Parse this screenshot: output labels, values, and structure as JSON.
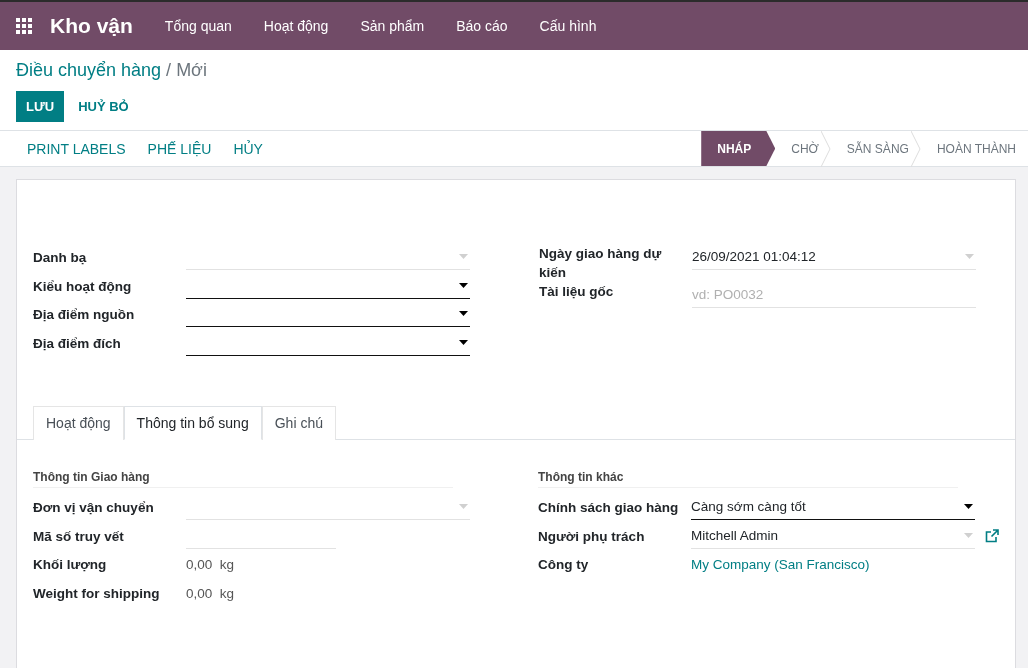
{
  "navbar": {
    "app_name": "Kho vận",
    "menu": [
      "Tổng quan",
      "Hoạt động",
      "Sản phẩm",
      "Báo cáo",
      "Cấu hình"
    ]
  },
  "breadcrumb": {
    "parent": "Điều chuyển hàng",
    "separator": "/",
    "current": "Mới"
  },
  "actions": [
    {
      "label": "LƯU",
      "primary": true
    },
    {
      "label": "HUỶ BỎ",
      "primary": false
    }
  ],
  "header_buttons": [
    "PRINT LABELS",
    "PHẾ LIỆU",
    "HỦY"
  ],
  "status_steps": [
    {
      "label": "NHÁP",
      "selected": true
    },
    {
      "label": "CHỜ",
      "selected": false
    },
    {
      "label": "SẴN SÀNG",
      "selected": false
    },
    {
      "label": "HOÀN THÀNH",
      "selected": false
    }
  ],
  "main_left": [
    {
      "label": "Danh bạ",
      "kind": "select",
      "required": false
    },
    {
      "label": "Kiểu hoạt động",
      "kind": "select",
      "required": true
    },
    {
      "label": "Địa điểm nguồn",
      "kind": "select",
      "required": true
    },
    {
      "label": "Địa điểm đích",
      "kind": "select",
      "required": true
    }
  ],
  "main_right": [
    {
      "label": "Ngày giao hàng dự kiến",
      "kind": "select",
      "required": false,
      "value": "26/09/2021 01:04:12"
    },
    {
      "label": "Tài liệu gốc",
      "kind": "text",
      "required": false,
      "placeholder": "vd: PO0032"
    }
  ],
  "tabs": [
    {
      "label": "Hoạt động",
      "selected": false
    },
    {
      "label": "Thông tin bổ sung",
      "selected": true
    },
    {
      "label": "Ghi chú",
      "selected": false
    }
  ],
  "groups": [
    {
      "title": "Thông tin Giao hàng",
      "fields": [
        {
          "label": "Đơn vị vận chuyển",
          "kind": "select",
          "required": false
        },
        {
          "label": "Mã số truy vết",
          "kind": "short_text"
        },
        {
          "label": "Khối lượng",
          "kind": "readonly",
          "value": "0,00",
          "unit": "kg"
        },
        {
          "label": "Weight for shipping",
          "kind": "readonly",
          "value": "0,00",
          "unit": "kg"
        }
      ]
    },
    {
      "title": "Thông tin khác",
      "fields": [
        {
          "label": "Chính sách giao hàng",
          "kind": "select",
          "required": true,
          "value": "Càng sớm càng tốt"
        },
        {
          "label": "Người phụ trách",
          "kind": "select",
          "required": false,
          "value": "Mitchell Admin",
          "external_link": true
        },
        {
          "label": "Công ty",
          "kind": "link",
          "value": "My Company (San Francisco)"
        }
      ]
    }
  ]
}
